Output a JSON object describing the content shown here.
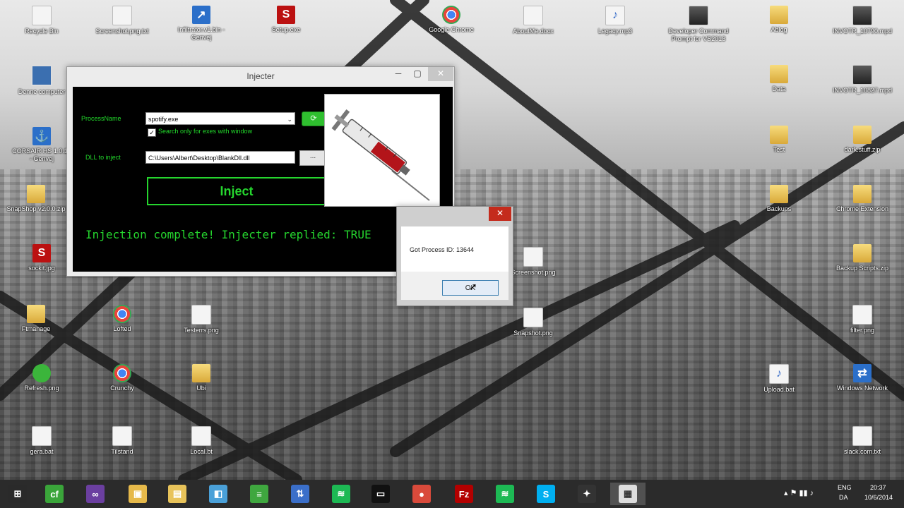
{
  "desktop_icons": [
    {
      "label": "Recycle Bin",
      "icon": "recycle-bin-icon"
    },
    {
      "label": "Screenshot.png.txt",
      "icon": "document-icon"
    },
    {
      "label": "Infiltrator.v1.bin - Genvej",
      "icon": "shortcut-icon"
    },
    {
      "label": "Setup.exe",
      "icon": "red-s-icon"
    },
    {
      "label": "Google Chrome",
      "icon": "chrome-icon"
    },
    {
      "label": "AboutMe.docx",
      "icon": "document-icon"
    },
    {
      "label": "Legacy.mp3",
      "icon": "audio-icon"
    },
    {
      "label": "Developer Command Prompt for VS2013",
      "icon": "console-icon"
    },
    {
      "label": "Ablog",
      "icon": "folder-icon"
    },
    {
      "label": "INVOTR_10790.mpd",
      "icon": "video-icon"
    },
    {
      "label": "Denne computer",
      "icon": "computer-icon"
    },
    {
      "label": "Data",
      "icon": "folder-icon"
    },
    {
      "label": "INVOTR_10827.mpd",
      "icon": "video-icon"
    },
    {
      "label": "CORSAIR HS 1.0.10 - Genvej",
      "icon": "corsair-icon"
    },
    {
      "label": "Test",
      "icon": "folder-icon"
    },
    {
      "label": "dark.stuff.zip",
      "icon": "zip-icon"
    },
    {
      "label": "SnapShop v2.0.0.zip",
      "icon": "zip-icon"
    },
    {
      "label": "Backups",
      "icon": "folder-icon"
    },
    {
      "label": "Chrome Extension",
      "icon": "zip-icon"
    },
    {
      "label": "sockit.jpg",
      "icon": "red-s-icon"
    },
    {
      "label": "Screenshot.png",
      "icon": "document-icon"
    },
    {
      "label": "Backup Scripts.zip",
      "icon": "zip-icon"
    },
    {
      "label": "Ftmanage",
      "icon": "zip-icon"
    },
    {
      "label": "Lofted",
      "icon": "chrome-icon"
    },
    {
      "label": "Testerrs.png",
      "icon": "image-icon"
    },
    {
      "label": "Snapshot.png",
      "icon": "image-icon"
    },
    {
      "label": "filter.png",
      "icon": "image-icon"
    },
    {
      "label": "Refresh.png",
      "icon": "green-icon"
    },
    {
      "label": "Crunchy",
      "icon": "chrome-icon"
    },
    {
      "label": "Ubi",
      "icon": "zip-icon"
    },
    {
      "label": "Upload.bat",
      "icon": "audio-icon"
    },
    {
      "label": "Windows Network",
      "icon": "network-icon"
    },
    {
      "label": "gera.bat",
      "icon": "image-icon"
    },
    {
      "label": "Tilstand",
      "icon": "document-icon"
    },
    {
      "label": "Local.bt",
      "icon": "image-icon"
    },
    {
      "label": "slack.com.txt",
      "icon": "document-icon"
    }
  ],
  "injecter": {
    "title": "Injecter",
    "min": "─",
    "max": "▢",
    "close": "✕",
    "process_label": "ProcessName",
    "process_value": "spotify.exe",
    "checkbox_label": "Search only for exes with window",
    "checkbox_checked": true,
    "dll_label": "DLL to inject",
    "dll_value": "C:\\Users\\Albert\\Desktop\\BlankDll.dll",
    "browse": "...",
    "inject": "Inject",
    "status": "Injection complete! Injecter replied: TRUE"
  },
  "msgbox": {
    "close": "✕",
    "text": "Got Process ID: 13644",
    "ok": "OK"
  },
  "taskbar": {
    "items": [
      {
        "name": "start-button",
        "glyph": "⊞",
        "color": "#2a2a2a"
      },
      {
        "name": "taskbar-cf",
        "glyph": "cf",
        "color": "#3aa53a"
      },
      {
        "name": "taskbar-visual-studio",
        "glyph": "∞",
        "color": "#6b3fa0"
      },
      {
        "name": "taskbar-photo",
        "glyph": "▣",
        "color": "#e6b94a"
      },
      {
        "name": "taskbar-explorer",
        "glyph": "▤",
        "color": "#e8c35a"
      },
      {
        "name": "taskbar-paint",
        "glyph": "◧",
        "color": "#4aa0d8"
      },
      {
        "name": "taskbar-notepad",
        "glyph": "≡",
        "color": "#3fa73f"
      },
      {
        "name": "taskbar-network",
        "glyph": "⇅",
        "color": "#3b6fc9"
      },
      {
        "name": "taskbar-spotify",
        "glyph": "≋",
        "color": "#1db954"
      },
      {
        "name": "taskbar-console",
        "glyph": "▭",
        "color": "#111"
      },
      {
        "name": "taskbar-chrome",
        "glyph": "●",
        "color": "#d94a3b"
      },
      {
        "name": "taskbar-filezilla",
        "glyph": "Fz",
        "color": "#b30000"
      },
      {
        "name": "taskbar-spotify-2",
        "glyph": "≋",
        "color": "#1db954"
      },
      {
        "name": "taskbar-skype",
        "glyph": "S",
        "color": "#00aff0"
      },
      {
        "name": "taskbar-game",
        "glyph": "✦",
        "color": "#333"
      },
      {
        "name": "taskbar-injecter",
        "glyph": "▦",
        "color": "#ddd"
      }
    ],
    "lang": "ENG",
    "lang2": "DA",
    "time": "20:37",
    "date": "10/6/2014"
  }
}
